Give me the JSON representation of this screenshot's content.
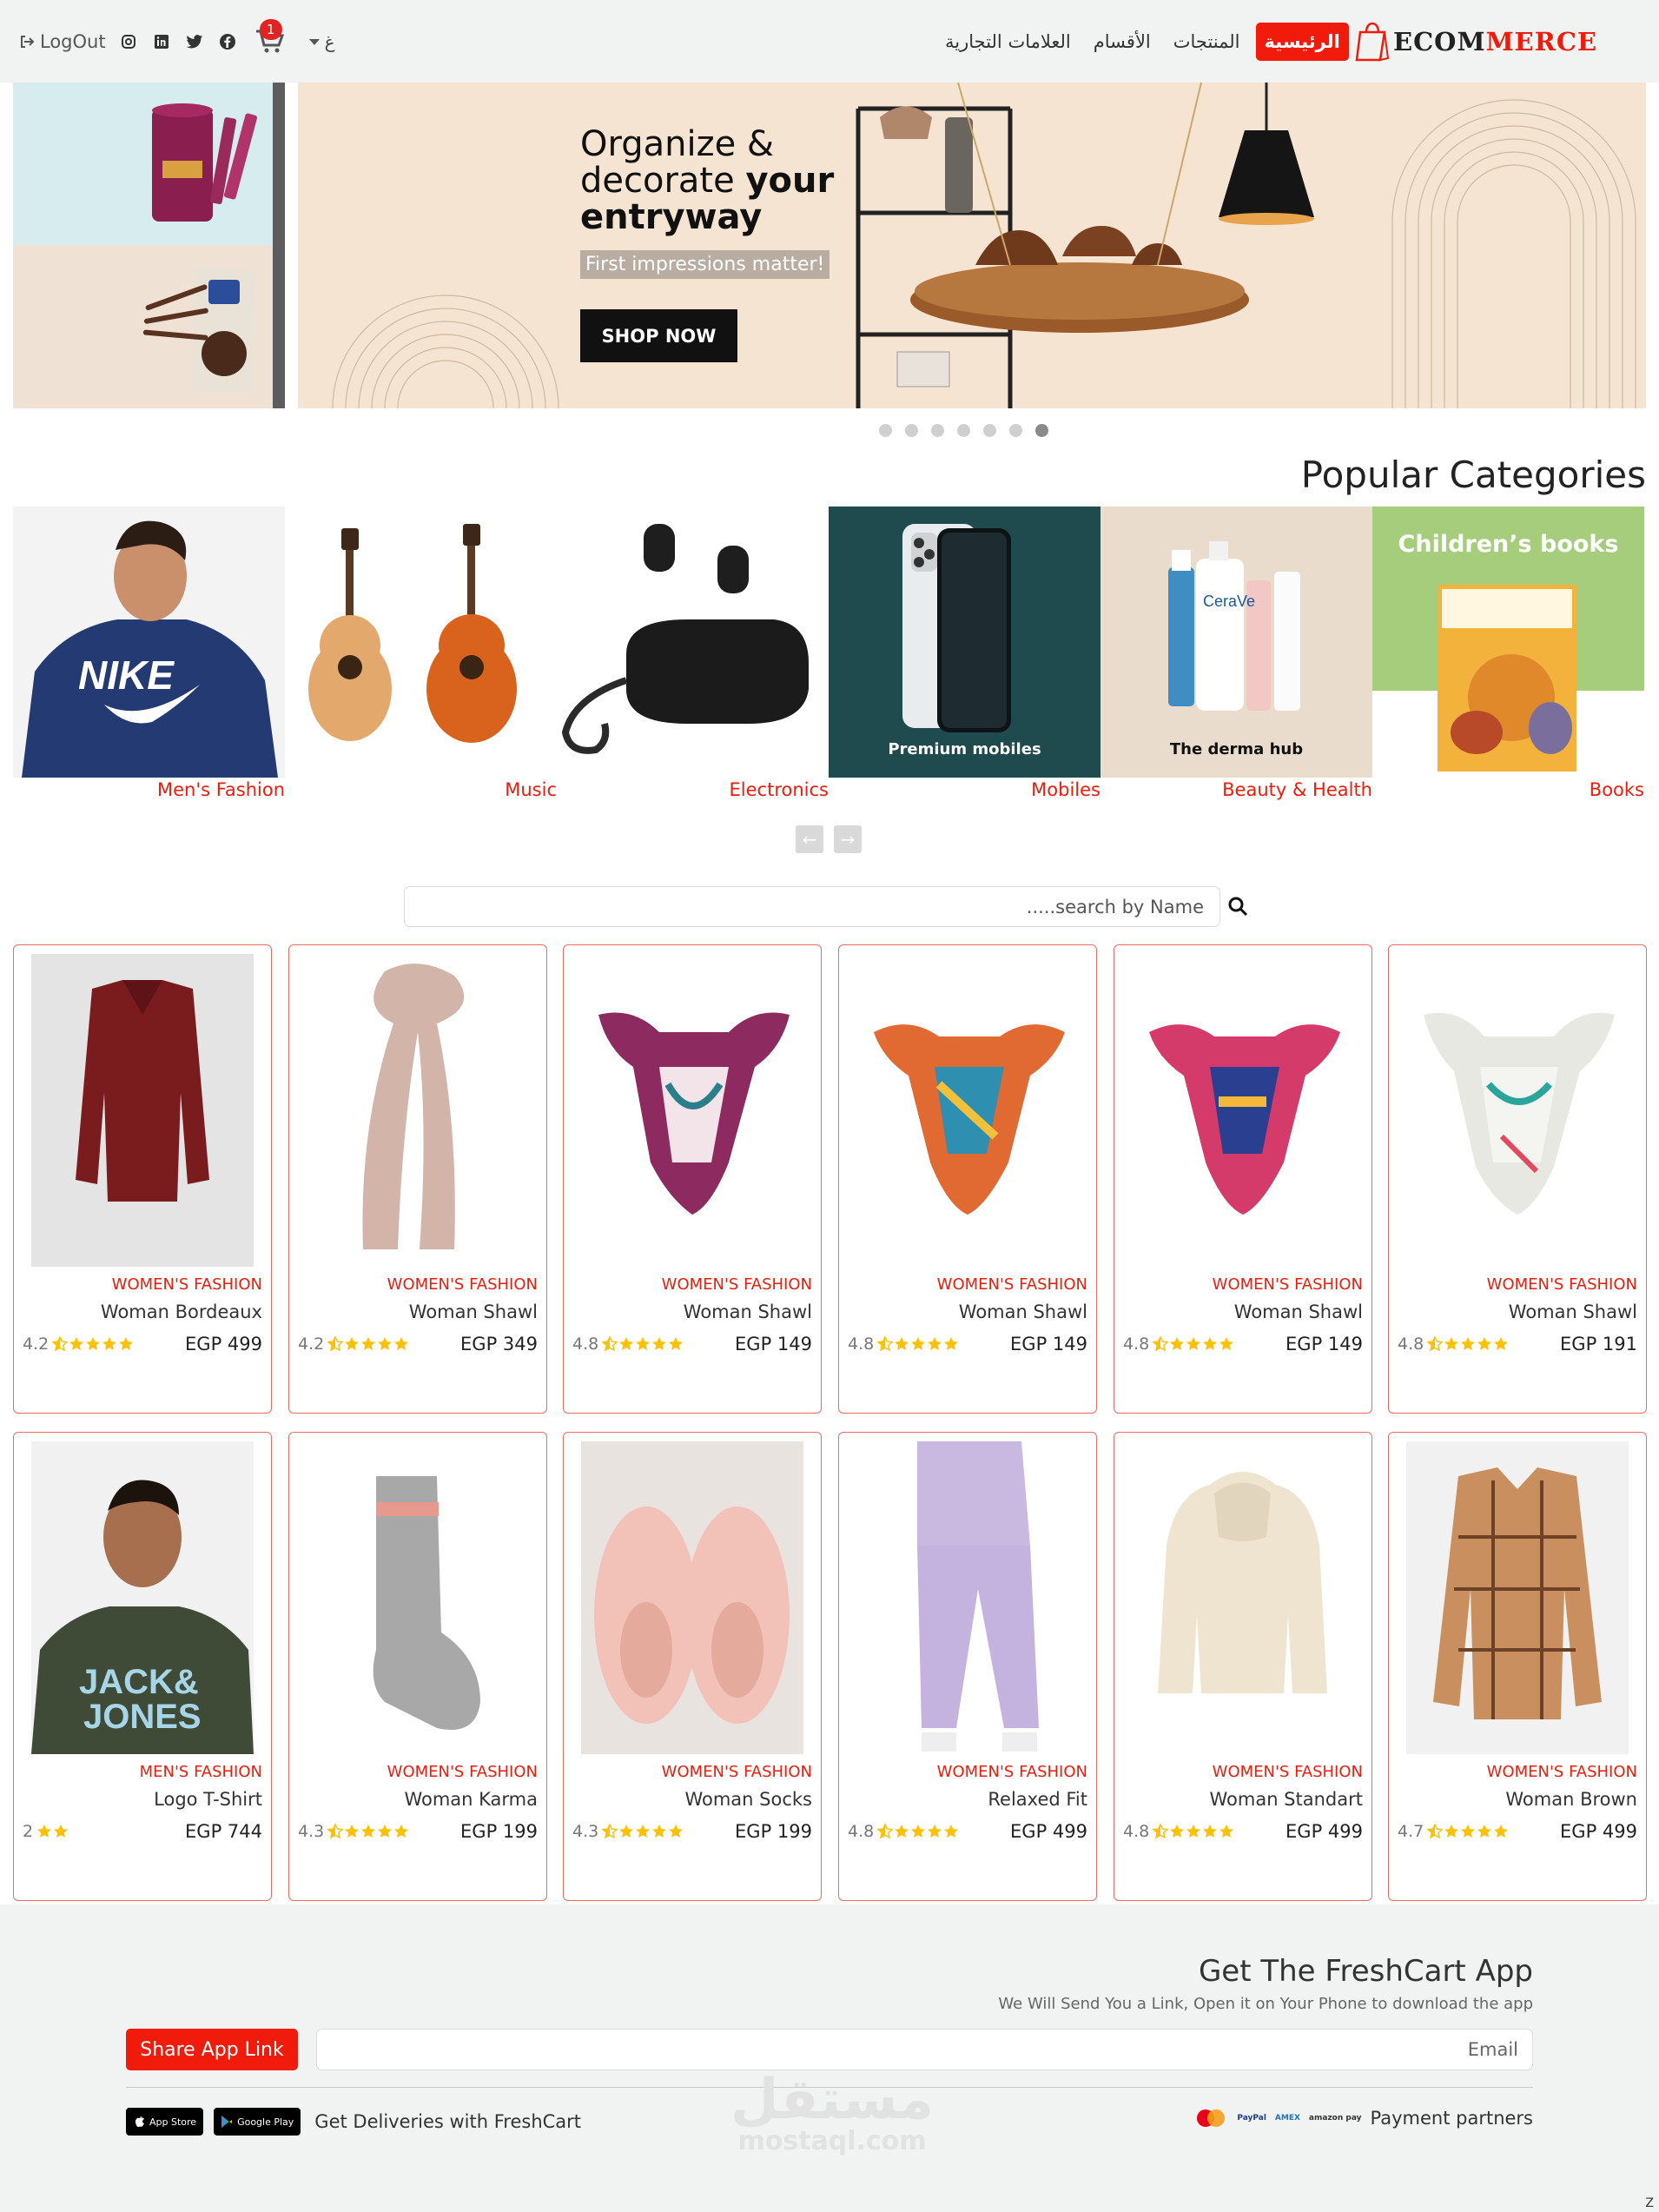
{
  "nav": {
    "logout": "LogOut",
    "cart_count": "1",
    "lang": "غ",
    "links": [
      "الرئيسية",
      "المنتجات",
      "الأقسام",
      "العلامات التجارية"
    ],
    "logo_a": "ECOM",
    "logo_b": "MERCE"
  },
  "hero": {
    "line1": "Organize &",
    "line2a": "decorate ",
    "line2b": "your",
    "line3": "entryway",
    "tag": "First impressions matter!",
    "button": "SHOP NOW",
    "slides": 7,
    "active_slide": 7
  },
  "categories": {
    "title": "Popular Categories",
    "items": [
      {
        "label": "Men's Fashion"
      },
      {
        "label": "Music"
      },
      {
        "label": "Electronics"
      },
      {
        "label": "Mobiles",
        "overlay": "Premium mobiles"
      },
      {
        "label": "Beauty & Health",
        "overlay": "The derma hub"
      },
      {
        "label": "Books",
        "overlay": "Children’s books"
      }
    ]
  },
  "search": {
    "placeholder": ".....search by Name"
  },
  "products": [
    {
      "category": "WOMEN'S FASHION",
      "name": "Woman Bordeaux",
      "rating": "4.2",
      "stars": 4.2,
      "price": "EGP 499"
    },
    {
      "category": "WOMEN'S FASHION",
      "name": "Woman Shawl",
      "rating": "4.2",
      "stars": 4.2,
      "price": "EGP 349"
    },
    {
      "category": "WOMEN'S FASHION",
      "name": "Woman Shawl",
      "rating": "4.8",
      "stars": 4.8,
      "price": "EGP 149"
    },
    {
      "category": "WOMEN'S FASHION",
      "name": "Woman Shawl",
      "rating": "4.8",
      "stars": 4.8,
      "price": "EGP 149"
    },
    {
      "category": "WOMEN'S FASHION",
      "name": "Woman Shawl",
      "rating": "4.8",
      "stars": 4.8,
      "price": "EGP 149"
    },
    {
      "category": "WOMEN'S FASHION",
      "name": "Woman Shawl",
      "rating": "4.8",
      "stars": 4.8,
      "price": "EGP 191"
    },
    {
      "category": "MEN'S FASHION",
      "name": "Logo T-Shirt",
      "rating": "2",
      "stars": 2,
      "price": "EGP 744"
    },
    {
      "category": "WOMEN'S FASHION",
      "name": "Woman Karma",
      "rating": "4.3",
      "stars": 4.3,
      "price": "EGP 199"
    },
    {
      "category": "WOMEN'S FASHION",
      "name": "Woman Socks",
      "rating": "4.3",
      "stars": 4.3,
      "price": "EGP 199"
    },
    {
      "category": "WOMEN'S FASHION",
      "name": "Relaxed Fit",
      "rating": "4.8",
      "stars": 4.8,
      "price": "EGP 499"
    },
    {
      "category": "WOMEN'S FASHION",
      "name": "Woman Standart",
      "rating": "4.8",
      "stars": 4.8,
      "price": "EGP 499"
    },
    {
      "category": "WOMEN'S FASHION",
      "name": "Woman Brown",
      "rating": "4.7",
      "stars": 4.7,
      "price": "EGP 499"
    }
  ],
  "footer": {
    "title": "Get The FreshCart App",
    "subtitle": "We Will Send You a Link, Open it on Your Phone to download the app",
    "share_button": "Share App Link",
    "email_placeholder": "Email",
    "deliveries": "Get Deliveries with FreshCart",
    "payment": "Payment partners",
    "app_store": "App Store",
    "google_play": "Google Play",
    "watermark_ar": "مستقل",
    "watermark_en": "mostaql.com",
    "corner": "Z"
  },
  "colors": {
    "accent": "#f01b0a",
    "star": "#ffc107"
  }
}
